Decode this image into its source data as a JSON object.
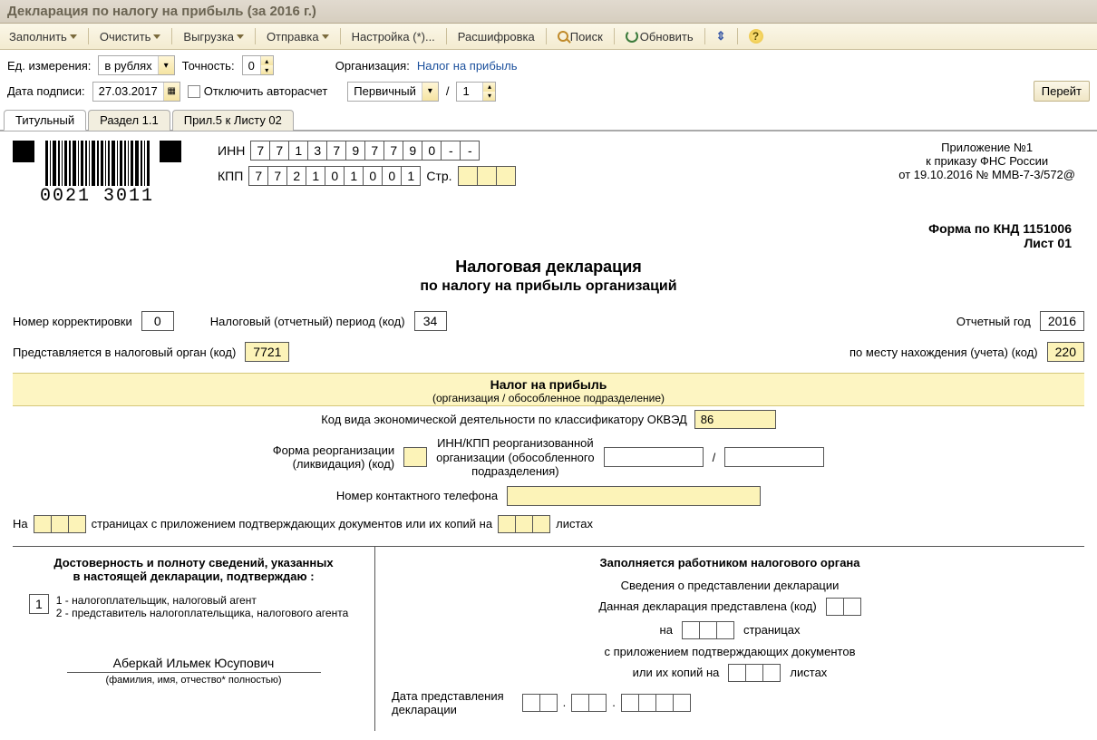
{
  "title": "Декларация по налогу на прибыль (за 2016 г.)",
  "toolbar": {
    "fill": "Заполнить",
    "clear": "Очистить",
    "upload": "Выгрузка",
    "send": "Отправка",
    "settings": "Настройка (*)...",
    "decode": "Расшифровка",
    "search": "Поиск",
    "refresh": "Обновить"
  },
  "params": {
    "unit_label": "Ед. измерения:",
    "unit_value": "в рублях",
    "precision_label": "Точность:",
    "precision_value": "0",
    "org_label": "Организация:",
    "org_value": "Налог на прибыль",
    "sign_date_label": "Дата подписи:",
    "sign_date_value": "27.03.2017",
    "disable_calc": "Отключить авторасчет",
    "kind_value": "Первичный",
    "slash": "/",
    "num_value": "1",
    "goto": "Перейт"
  },
  "tabs": {
    "t1": "Титульный",
    "t2": "Раздел 1.1",
    "t3": "Прил.5 к Листу 02"
  },
  "barcode": "0021 3011",
  "inn": {
    "label": "ИНН",
    "d": [
      "7",
      "7",
      "1",
      "3",
      "7",
      "9",
      "7",
      "7",
      "9",
      "0",
      "-",
      "-"
    ]
  },
  "kpp": {
    "label": "КПП",
    "d": [
      "7",
      "7",
      "2",
      "1",
      "0",
      "1",
      "0",
      "0",
      "1"
    ],
    "str_label": "Стр."
  },
  "appendix": {
    "l1": "Приложение №1",
    "l2": "к приказу ФНС России",
    "l3": "от 19.10.2016 № ММВ-7-3/572@"
  },
  "form_code": "Форма по КНД 1151006",
  "sheet": "Лист 01",
  "dec_title": "Налоговая декларация",
  "dec_subtitle": "по налогу на прибыль организаций",
  "line1": {
    "corr_label": "Номер корректировки",
    "corr_value": "0",
    "period_label": "Налоговый (отчетный) период (код)",
    "period_value": "34",
    "year_label": "Отчетный год",
    "year_value": "2016"
  },
  "line2": {
    "organ_label": "Представляется в налоговый орган (код)",
    "organ_value": "7721",
    "place_label": "по месту нахождения (учета) (код)",
    "place_value": "220"
  },
  "band": {
    "title": "Налог на прибыль",
    "sub": "(организация / обособленное подразделение)"
  },
  "okved": {
    "label": "Код вида экономической деятельности по классификатору ОКВЭД",
    "value": "86"
  },
  "reorg": {
    "label1": "Форма реорганизации",
    "label2": "(ликвидация) (код)",
    "innkpp1": "ИНН/КПП реорганизованной",
    "innkpp2": "организации (обособленного",
    "innkpp3": "подразделения)",
    "slash": "/"
  },
  "phone_label": "Номер контактного телефона",
  "pages": {
    "na": "На",
    "pages_text": "страницах с приложением подтверждающих документов или их копий на",
    "sheets_text": "листах"
  },
  "cert": {
    "title1": "Достоверность и полноту сведений, указанных",
    "title2": "в настоящей декларации, подтверждаю :",
    "code": "1",
    "opt1": "1 - налогоплательщик, налоговый агент",
    "opt2": "2 - представитель налогоплательщика, налогового агента",
    "fio": "Аберкай Ильмек Юсупович",
    "fio_cap": "(фамилия, имя, отчество* полностью)"
  },
  "filled_by": {
    "title": "Заполняется работником налогового органа",
    "info": "Сведения о представлении декларации",
    "presented": "Данная декларация представлена  (код)",
    "on": "на",
    "pages": "страницах",
    "attach": "с приложением подтверждающих документов",
    "copies": "или их копий на",
    "sheets": "листах",
    "date1": "Дата представления",
    "date2": "декларации",
    "dot": "."
  }
}
